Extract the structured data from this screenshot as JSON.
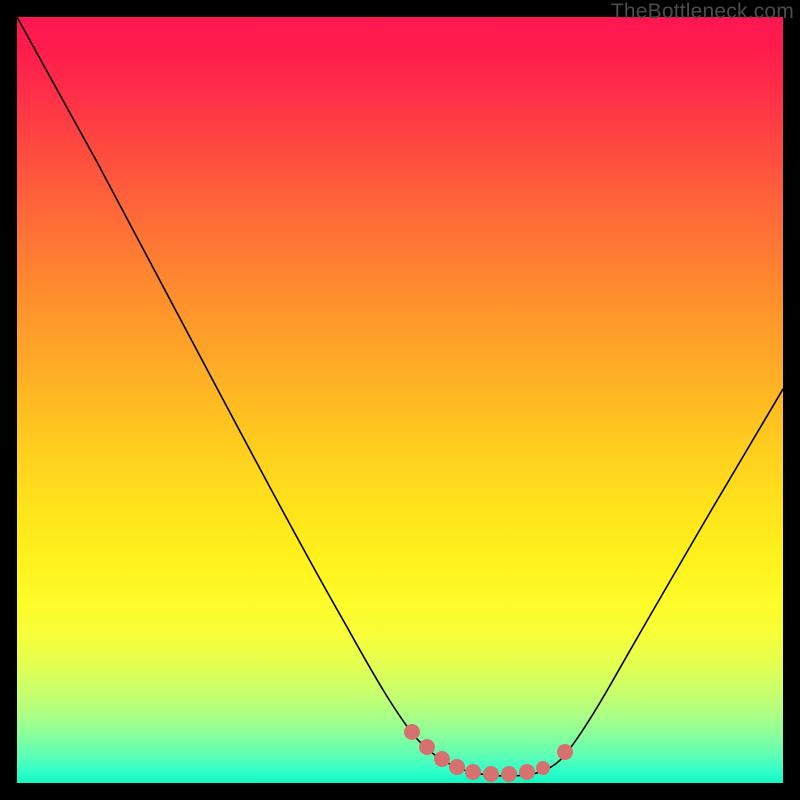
{
  "credit_text": "TheBottleneck.com",
  "chart_data": {
    "type": "line",
    "title": "",
    "xlabel": "",
    "ylabel": "",
    "xlim": [
      0,
      1
    ],
    "ylim": [
      0,
      1
    ],
    "grid": false,
    "series": [
      {
        "name": "bottleneck-curve",
        "x": [
          0.0,
          0.04,
          0.08,
          0.12,
          0.16,
          0.2,
          0.24,
          0.28,
          0.32,
          0.36,
          0.4,
          0.44,
          0.48,
          0.5,
          0.52,
          0.54,
          0.56,
          0.58,
          0.6,
          0.62,
          0.64,
          0.66,
          0.68,
          0.7,
          0.74,
          0.78,
          0.82,
          0.86,
          0.9,
          0.94,
          0.98,
          1.0
        ],
        "y": [
          1.0,
          0.925,
          0.85,
          0.775,
          0.7,
          0.625,
          0.55,
          0.475,
          0.4,
          0.325,
          0.255,
          0.19,
          0.13,
          0.1,
          0.075,
          0.055,
          0.04,
          0.028,
          0.02,
          0.015,
          0.012,
          0.012,
          0.014,
          0.02,
          0.055,
          0.115,
          0.185,
          0.26,
          0.34,
          0.42,
          0.5,
          0.54
        ]
      }
    ],
    "markers": [
      {
        "name": "left-dot",
        "x": 0.515,
        "y": 0.07
      },
      {
        "name": "flat-dots",
        "x": 0.555,
        "y": 0.035
      },
      {
        "name": "flat-dots",
        "x": 0.59,
        "y": 0.022
      },
      {
        "name": "flat-dots",
        "x": 0.62,
        "y": 0.016
      },
      {
        "name": "flat-dots",
        "x": 0.65,
        "y": 0.015
      },
      {
        "name": "flat-dots",
        "x": 0.68,
        "y": 0.018
      },
      {
        "name": "right-dot",
        "x": 0.715,
        "y": 0.04
      }
    ],
    "colors": {
      "curve": "#000000",
      "marker": "#d6716f"
    }
  }
}
